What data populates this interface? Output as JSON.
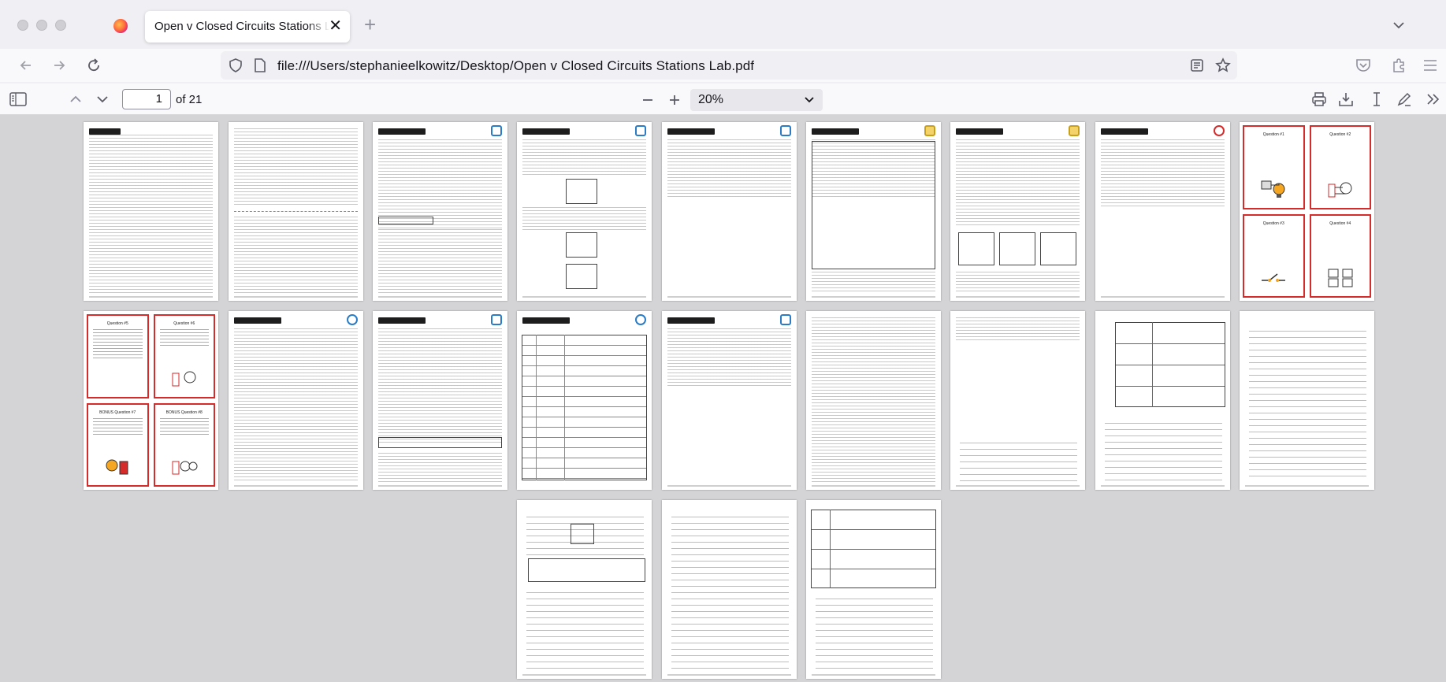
{
  "window": {
    "tab_title": "Open v Closed Circuits Stations Lab.pdf",
    "url": "file:///Users/stephanieelkowitz/Desktop/Open v Closed Circuits Stations Lab.pdf"
  },
  "pdf_toolbar": {
    "current_page": "1",
    "page_total": "of 21",
    "zoom": "20%"
  },
  "thumbnails": {
    "count": 21,
    "card_titles": [
      "Question #1",
      "Question #2",
      "Question #3",
      "Question #4",
      "Question #5",
      "Question #6",
      "BONUS Question #7",
      "BONUS Question #8"
    ]
  },
  "colors": {
    "accent": "#0061e0",
    "card_border": "#d62b2b"
  }
}
